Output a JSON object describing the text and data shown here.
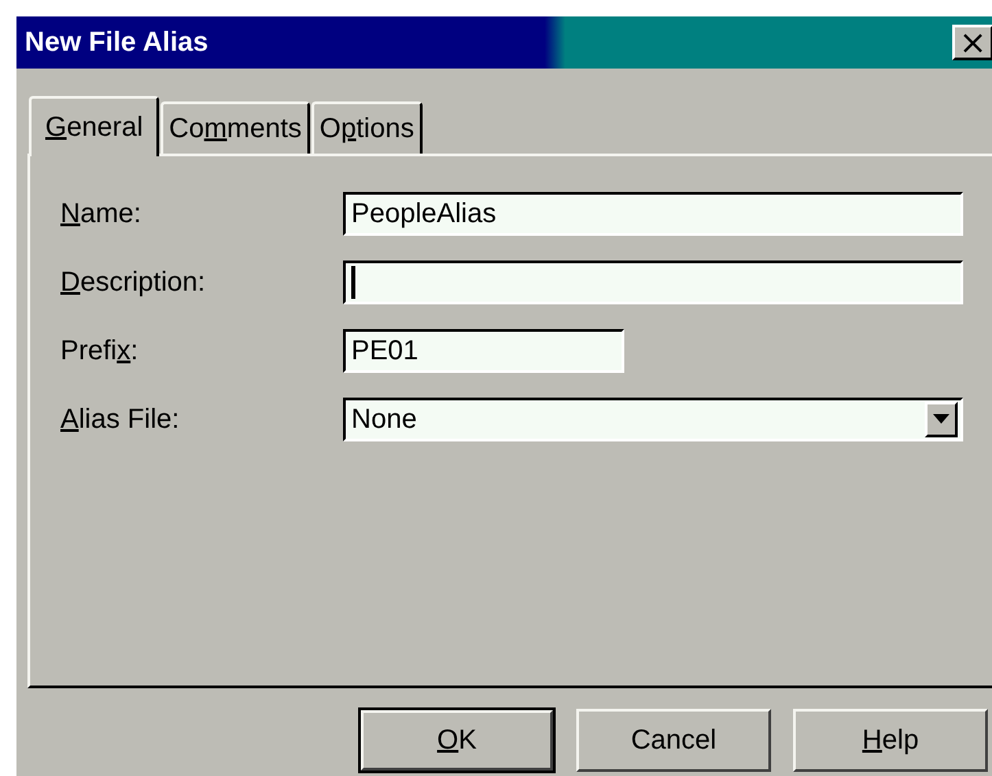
{
  "window": {
    "title": "New File Alias",
    "close_label": "×"
  },
  "tabs": [
    {
      "mnemonic": "G",
      "label_post": "eneral",
      "selected": true
    },
    {
      "label_pre": "Co",
      "mnemonic": "m",
      "label_post": "ments",
      "selected": false
    },
    {
      "label_pre": "O",
      "mnemonic": "p",
      "label_post": "tions",
      "selected": false
    }
  ],
  "fields": [
    {
      "kind": "text",
      "mnemonic": "N",
      "label_post": "ame:",
      "value": "PeopleAlias",
      "focused": false,
      "wide": true
    },
    {
      "kind": "text",
      "mnemonic": "D",
      "label_post": "escription:",
      "focused": true,
      "wide": true
    },
    {
      "kind": "text",
      "label_pre": "Prefi",
      "mnemonic": "x",
      "label_post": ":",
      "value": "PE01",
      "focused": false,
      "wide": false
    },
    {
      "kind": "dropdown",
      "mnemonic": "A",
      "label_post": "lias File:",
      "value": "None",
      "focused": false,
      "wide": true
    }
  ],
  "buttons": [
    {
      "mnemonic": "O",
      "label_post": "K",
      "default": true
    },
    {
      "label_pre": "Cancel",
      "default": false
    },
    {
      "mnemonic": "H",
      "label_post": "elp",
      "default": false
    }
  ]
}
